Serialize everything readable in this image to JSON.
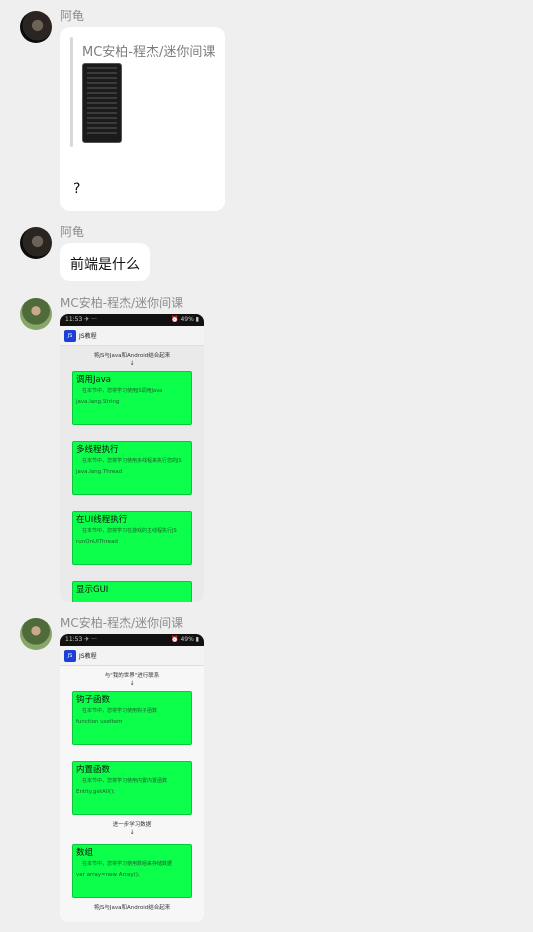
{
  "messages": [
    {
      "sender": "阿龟",
      "quote_title": "MC安柏-程杰/迷你间课",
      "text": "?"
    },
    {
      "sender": "阿龟",
      "text": "前端是什么"
    },
    {
      "sender": "MC安柏-程杰/迷你间课",
      "screenshot": {
        "status_left": "11:53 ✈ ···",
        "status_right": "⏰ 49% ▮",
        "app_icon": "JS",
        "app_title": "JS教程",
        "hint": "将JS与Java和Android结合起来",
        "arrow": "↓",
        "cards": [
          {
            "title": "调用Java",
            "desc": "在本节中，您将学习使用JS调用Java",
            "code": "java.lang.String"
          },
          {
            "title": "多线程执行",
            "desc": "在本节中，您将学习使用多线程来执行您的JS",
            "code": "java.lang.Thread"
          },
          {
            "title": "在UI线程执行",
            "desc": "在本节中，您将学习在游戏的主线程执行JS",
            "code": "runOnUIThread"
          },
          {
            "title": "显示GUI",
            "desc": "",
            "code": ""
          }
        ]
      }
    },
    {
      "sender": "MC安柏-程杰/迷你间课",
      "screenshot": {
        "status_left": "11:53 ✈ ···",
        "status_right": "⏰ 49% ▮",
        "app_icon": "JS",
        "app_title": "JS教程",
        "hint": "与\"我的世界\"进行联系",
        "arrow": "↓",
        "cards": [
          {
            "title": "钩子函数",
            "desc": "在本节中，您将学习使用钩子函数",
            "code": "function useItem"
          },
          {
            "title": "内置函数",
            "desc": "在本节中，您将学习使用内置内置函数",
            "code": "Entity.getAll();"
          }
        ],
        "hint2": "进一步学习数据",
        "arrow2": "↓",
        "cards2": [
          {
            "title": "数组",
            "desc": "在本节中，您将学习使用数组来存储数据",
            "code": "var array=new Array();"
          }
        ],
        "hint3": "将JS与Java和Android结合起来"
      }
    }
  ],
  "icons": [
    "avatar-turtle",
    "avatar-mc",
    "js-app-icon",
    "down-arrow-icon"
  ]
}
